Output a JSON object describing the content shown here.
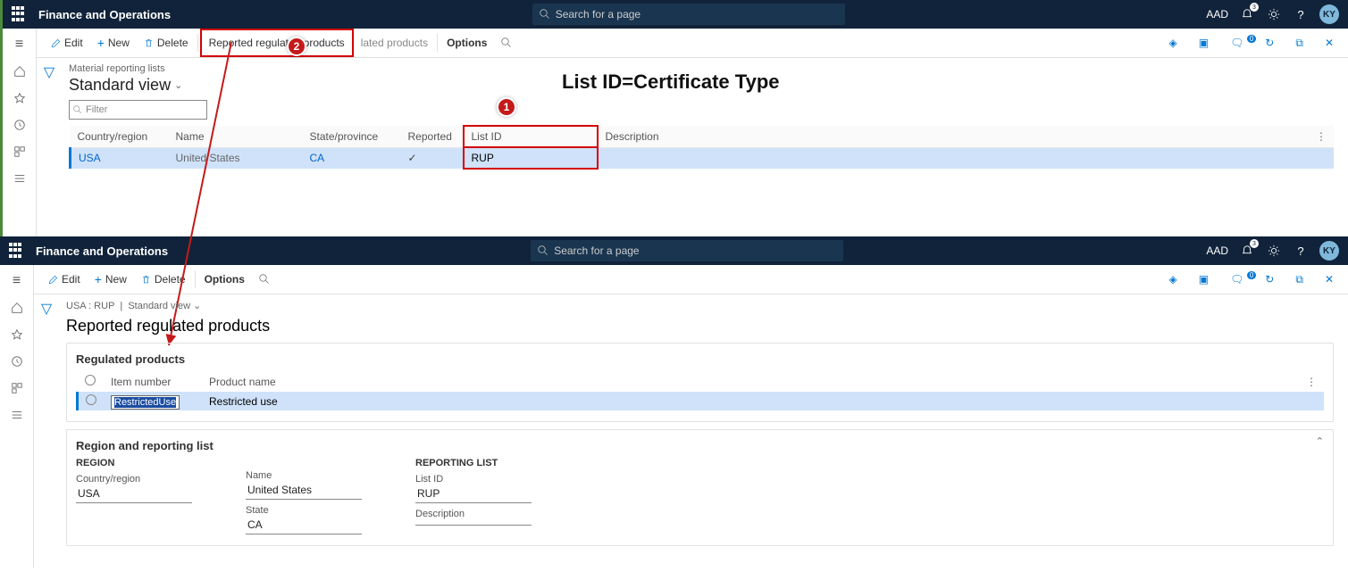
{
  "shell": {
    "app_title": "Finance and Operations",
    "search_placeholder": "Search for a page",
    "tenant": "AAD",
    "notif_count": "3",
    "avatar": "KY"
  },
  "inst1": {
    "cmdbar": {
      "edit": "Edit",
      "new": "New",
      "delete": "Delete",
      "reported": "Reported regulated products",
      "obscured": "lated products",
      "options": "Options",
      "badge": "0"
    },
    "crumb": "Material reporting lists",
    "view": "Standard view",
    "filter_placeholder": "Filter",
    "columns": {
      "country": "Country/region",
      "name": "Name",
      "state": "State/province",
      "reported": "Reported",
      "listid": "List ID",
      "description": "Description"
    },
    "row": {
      "country": "USA",
      "name": "United States",
      "state": "CA",
      "reported_check": "✓",
      "listid": "RUP",
      "description": ""
    },
    "annotation_heading": "List ID=Certificate Type",
    "callout1": "1",
    "callout2": "2"
  },
  "inst2": {
    "cmdbar": {
      "edit": "Edit",
      "new": "New",
      "delete": "Delete",
      "options": "Options",
      "badge": "0"
    },
    "crumb_a": "USA : RUP",
    "crumb_b": "Standard view",
    "title": "Reported regulated products",
    "section1": "Regulated products",
    "columns": {
      "item": "Item number",
      "product": "Product name"
    },
    "row": {
      "item": "RestrictedUse",
      "product": "Restricted use"
    },
    "section2": "Region and reporting list",
    "region_hdr": "REGION",
    "country_lbl": "Country/region",
    "country_val": "USA",
    "name_lbl": "Name",
    "name_val": "United States",
    "state_lbl": "State",
    "state_val": "CA",
    "reporting_hdr": "REPORTING LIST",
    "listid_lbl": "List ID",
    "listid_val": "RUP",
    "desc_lbl": "Description",
    "desc_val": ""
  }
}
